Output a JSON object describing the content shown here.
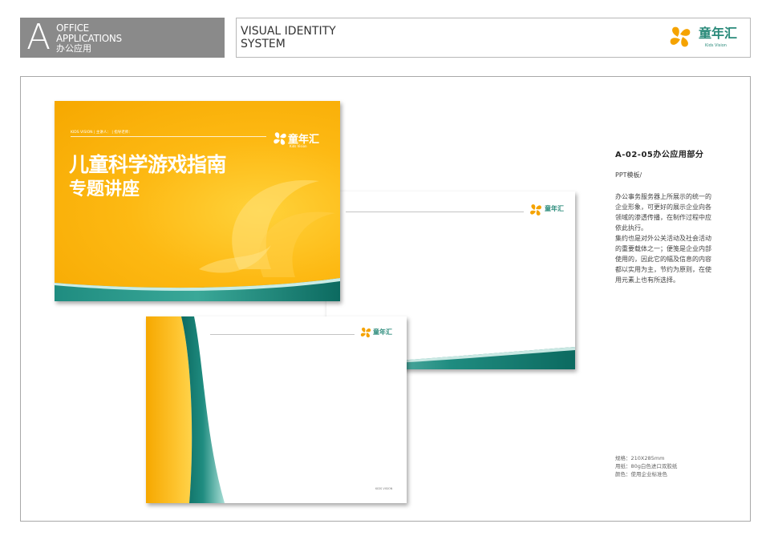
{
  "header": {
    "section_letter": "A",
    "section_en_line1": "OFFICE",
    "section_en_line2": "APPLICATIONS",
    "section_cn": "办公应用",
    "vi_line1": "VISUAL IDENTITY",
    "vi_line2": "SYSTEM",
    "logo_cn": "童年汇",
    "logo_en": "Kids Vision"
  },
  "ppt_cover": {
    "small_text": "KIDS VISION  |  主讲人：  |  指导老师：",
    "title_line1": "儿童科学游戏指南",
    "title_line2": "专题讲座",
    "logo_cn": "童年汇",
    "logo_en": "Kids Vision"
  },
  "letter_sheet": {
    "logo_cn": "童年汇"
  },
  "envelope": {
    "logo_cn": "童年汇",
    "footer": "KIDS VISION"
  },
  "description": {
    "title": "A-02-05办公应用部分",
    "subtitle": "PPT模板/",
    "lines": [
      "办公事务服务器上所展示的统一的",
      "企业形象，可更好的展示企业向各",
      "领域的渗透传播，在制作过程中应",
      "依此执行。",
      "集约也是对外公关活动及社会活动",
      "的重要载体之一；便笺是企业内部",
      "使用的，因此它的幅及信息的内容",
      "都以实用为主，节约为原则，在使",
      "用元素上也有所选择。"
    ]
  },
  "specs": {
    "size": "规格：210X285mm",
    "paper": "用纸：80g白色进口双胶纸",
    "color": "颜色：使用企业标准色"
  },
  "colors": {
    "brand_orange": "#fdb913",
    "brand_teal": "#1f8c80",
    "header_gray": "#8a8a8a"
  }
}
